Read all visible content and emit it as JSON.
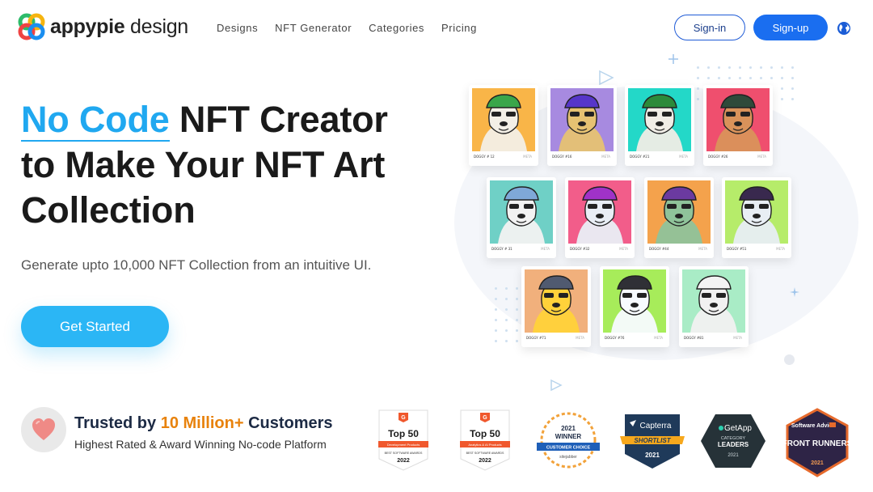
{
  "header": {
    "logo_brand": "appypie",
    "logo_product": "design",
    "nav": [
      "Designs",
      "NFT Generator",
      "Categories",
      "Pricing"
    ],
    "signin_label": "Sign-in",
    "signup_label": "Sign-up",
    "language_icon": "globe-icon"
  },
  "hero": {
    "title_accent": "No Code",
    "title_line1_rest": " NFT Creator",
    "title_line2": "to Make Your NFT Art",
    "title_line3": "Collection",
    "subtitle": "Generate upto 10,000 NFT Collection from an intuitive UI.",
    "cta_label": "Get Started"
  },
  "nft_cards": [
    {
      "caption": "DOGGY # 12",
      "meta": "META",
      "bg": "#f9b548"
    },
    {
      "caption": "DOGGY #16",
      "meta": "META",
      "bg": "#a78ae0"
    },
    {
      "caption": "DOGGY #21",
      "meta": "META",
      "bg": "#23d8c8"
    },
    {
      "caption": "DOGGY #26",
      "meta": "META",
      "bg": "#ef4f6e"
    },
    {
      "caption": "DOGGY # 31",
      "meta": "META",
      "bg": "#6fd0c6"
    },
    {
      "caption": "DOGGY #32",
      "meta": "META",
      "bg": "#f25d8a"
    },
    {
      "caption": "DOGGY #44",
      "meta": "META",
      "bg": "#f4a24c"
    },
    {
      "caption": "DOGGY #51",
      "meta": "META",
      "bg": "#b6ec6a"
    },
    {
      "caption": "DOGGY #71",
      "meta": "META",
      "bg": "#f1b07c"
    },
    {
      "caption": "DOGGY #76",
      "meta": "META",
      "bg": "#a7ec5a"
    },
    {
      "caption": "DOGGY #81",
      "meta": "META",
      "bg": "#a9ecc6"
    }
  ],
  "trust": {
    "title_prefix": "Trusted by ",
    "title_highlight": "10 Million+",
    "title_suffix": " Customers",
    "subtitle": "Highest Rated & Award Winning No-code Platform"
  },
  "badges": [
    {
      "name": "g2-top50-development",
      "brand": "G",
      "main": "Top 50",
      "ribbon": "Development Products",
      "small": "BEST SOFTWARE AWARDS",
      "year": "2022"
    },
    {
      "name": "g2-top50-analytics",
      "brand": "G",
      "main": "Top 50",
      "ribbon": "Analytics & AI Products",
      "small": "BEST SOFTWARE AWARDS",
      "year": "2022"
    },
    {
      "name": "sitejabber-winner",
      "year": "2021",
      "main": "WINNER",
      "ribbon": "CUSTOMER CHOICE",
      "small": "sitejabber"
    },
    {
      "name": "capterra-shortlist",
      "brand": "Capterra",
      "ribbon": "SHORTLIST",
      "year": "2021"
    },
    {
      "name": "getapp-category-leaders",
      "brand": "GetApp",
      "small": "CATEGORY",
      "main": "LEADERS",
      "year": "2021"
    },
    {
      "name": "software-advice-front-runners",
      "brand": "Software Advice",
      "main": "FRONT RUNNERS",
      "year": "2021"
    }
  ],
  "colors": {
    "accent": "#20a8f0",
    "primary_button": "#1a6ef0",
    "cta": "#2bb6f5",
    "highlight": "#e8820c"
  }
}
